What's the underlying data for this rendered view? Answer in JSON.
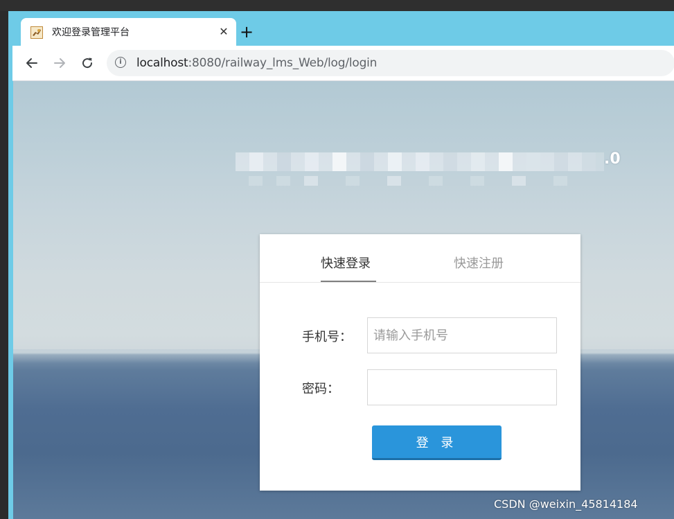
{
  "browser": {
    "tab_title": "欢迎登录管理平台",
    "tab_close": "✕",
    "new_tab": "+",
    "url_host": "localhost",
    "url_rest": ":8080/railway_lms_Web/log/login",
    "back_icon": "arrow-left-icon",
    "forward_icon": "arrow-right-icon",
    "reload_icon": "reload-icon",
    "info_icon": "info-icon"
  },
  "hero": {
    "title_suffix": ".0"
  },
  "login_panel": {
    "tabs": [
      {
        "label": "快速登录",
        "active": true
      },
      {
        "label": "快速注册",
        "active": false
      }
    ],
    "phone_label": "手机号：",
    "phone_placeholder": "请输入手机号",
    "phone_value": "",
    "password_label": "密码：",
    "password_value": "",
    "submit_label": "登 录"
  },
  "watermark": "CSDN @weixin_45814184",
  "colors": {
    "browser_frame": "#6ecbe7",
    "button": "#2a95db",
    "active_tab_text": "#333333",
    "inactive_tab_text": "#999999"
  }
}
